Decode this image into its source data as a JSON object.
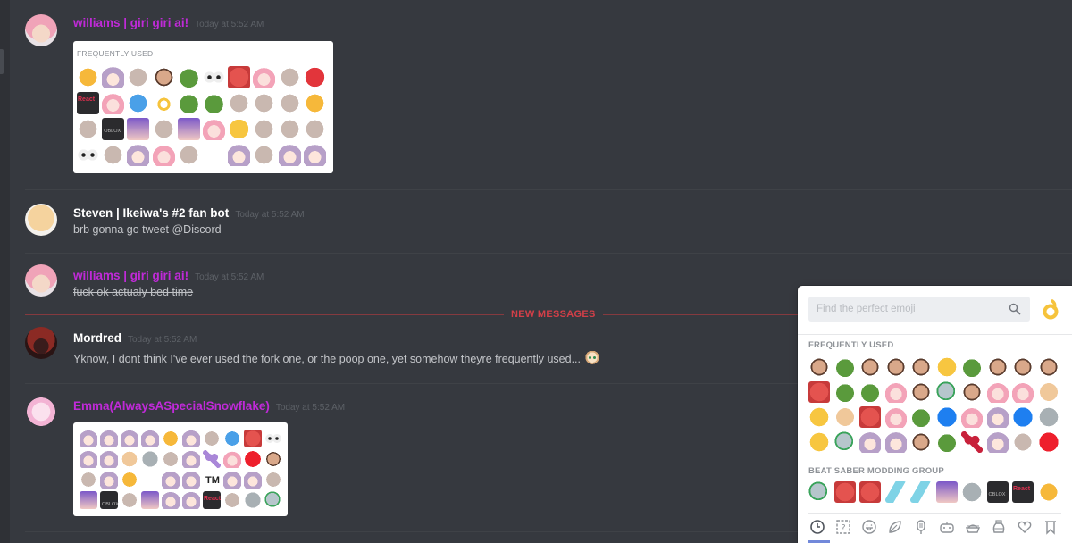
{
  "colors": {
    "background": "#36393f",
    "role_purple": "#c02ad8",
    "new_messages_red": "#d23f48",
    "picker_bg": "#ffffff",
    "picker_accent": "#7289da"
  },
  "messages": [
    {
      "author": "williams | giri giri ai!",
      "author_color": "purple",
      "timestamp": "Today at 5:52 AM",
      "attachment": {
        "type": "emoji-screenshot",
        "label": "FREQUENTLY USED",
        "emojis": [
          "carrot",
          "anime-girl-scream",
          "balloon",
          "man-face-laugh",
          "pepe",
          "eyes",
          "red-blur",
          "anime-girl-pink",
          "bomb",
          "angry-face",
          "react-playing",
          "anime-girl-pink-dance",
          "blue-box-point",
          "ok-hand",
          "pepe-scream",
          "pepe-sad",
          "cake",
          "gift",
          "frog-eyes",
          "thumbs-up",
          "hole",
          "oblox",
          "anime-girl-purple",
          "person-running",
          "anime-girl-purple-yell",
          "anime-girl-pink-cry",
          "frowning-face",
          "canada-flag-point",
          "hands-left",
          "hands-right",
          "eyes",
          "peace-hand",
          "anime-girl-dark",
          "anime-girl-pink-smile",
          "thinking-face-sideways",
          "blank",
          "anime-girl-facepalm",
          "police-car",
          "anime-girl-cat",
          "anime-girl-brown"
        ]
      }
    },
    {
      "author": "Steven | Ikeiwa's #2 fan bot",
      "author_color": "white",
      "timestamp": "Today at 5:52 AM",
      "text": "brb gonna go tweet @Discord"
    },
    {
      "author": "williams | giri giri ai!",
      "author_color": "purple",
      "timestamp": "Today at 5:52 AM",
      "text": "fuck ok actualy bed time",
      "strikethrough": true
    },
    {
      "author": "Mordred",
      "author_color": "white",
      "timestamp": "Today at 5:52 AM",
      "text": "Yknow, I dont think I've ever used the fork one, or the poop one, yet somehow theyre frequently used...",
      "trailing_emoji": "anime-blonde-face"
    },
    {
      "author": "Emma(AlwaysASpecialSnowflake)",
      "author_color": "purple",
      "timestamp": "Today at 5:52 AM",
      "attachment": {
        "type": "emoji-screenshot",
        "emojis": [
          "anime-girl-blue-hair",
          "anime-girl-red",
          "anime-girl-dark",
          "anime-girl-horns",
          "pikachu-yell",
          "anime-cat-blue",
          "witch-flying",
          "penguin-blue",
          "red-blur",
          "eyes",
          "rem",
          "anime-girl-brown",
          "rainbow-cat",
          "tv-robot",
          "eggplant",
          "anime-girl-red-hair",
          "purple-heart",
          "anime-girl-pink-dance",
          "red-square",
          "man-face-shout",
          "hammer",
          "ram",
          "rubber-duck",
          "blank",
          "anime-girl-question",
          "anime-girl-white",
          "tm",
          "anime-girl-auburn",
          "anime-girl-blue-long",
          "bomb",
          "purple-peace",
          "oblox",
          "rainbow-flag",
          "purple-octopus",
          "anime-girl-brown-wave",
          "anime-girl-red-short",
          "react-playing",
          "police-officer",
          "grey-photo",
          "grey-ghost"
        ]
      }
    }
  ],
  "divider": {
    "label": "NEW MESSAGES"
  },
  "emoji_picker": {
    "search_placeholder": "Find the perfect emoji",
    "search_value": "",
    "random_emoji": "ok-hand",
    "sections": [
      {
        "label": "FREQUENTLY USED",
        "emojis": [
          "man-laugh",
          "pepe",
          "man-selfie",
          "man-facepalm",
          "man-dark",
          "thinking-face",
          "pepe-scream",
          "man-face",
          "man-grey",
          "man-shout",
          "red-blur",
          "pepe",
          "pepe-sad",
          "anime-girl-pink-dance",
          "man-grey-round",
          "ghost-typing",
          "man-bald-yell",
          "anime-girl-pink-yell",
          "anime-girl-pink",
          "baby-face",
          "tongue-face",
          "cat-bread",
          "red-bird-yell",
          "anime-girl-pink-cry",
          "pepe-eyes",
          "blue-box-play",
          "anime-girl-pink-close",
          "anime-sunglasses",
          "blue-square-dot",
          "robot-grey",
          "grin-face",
          "ghost-typing",
          "anime-girl-sleep",
          "anime-girl-red-badge",
          "man-o-face",
          "pepe",
          "red-heart",
          "anime-girl-white",
          "doodle-badge",
          "red-square-dot"
        ]
      },
      {
        "label": "BEAT SABER MODDING GROUP",
        "emojis": [
          "ghost-typing",
          "saber-red",
          "saber-red",
          "saber-blue",
          "saber-blue",
          "purple-peace",
          "tv-robot",
          "oblox",
          "react-playing",
          "thumbs-up"
        ]
      }
    ],
    "nav": [
      {
        "icon": "clock-icon",
        "label": "Recent",
        "active": true
      },
      {
        "icon": "custom-box-icon",
        "label": "Custom"
      },
      {
        "icon": "tongue-face-icon",
        "label": "People"
      },
      {
        "icon": "leaf-icon",
        "label": "Nature"
      },
      {
        "icon": "popsicle-icon",
        "label": "Food"
      },
      {
        "icon": "gamepad-icon",
        "label": "Activities"
      },
      {
        "icon": "boat-icon",
        "label": "Travel"
      },
      {
        "icon": "potion-icon",
        "label": "Objects"
      },
      {
        "icon": "heart-icon",
        "label": "Symbols"
      },
      {
        "icon": "flag-icon",
        "label": "Flags"
      }
    ]
  }
}
